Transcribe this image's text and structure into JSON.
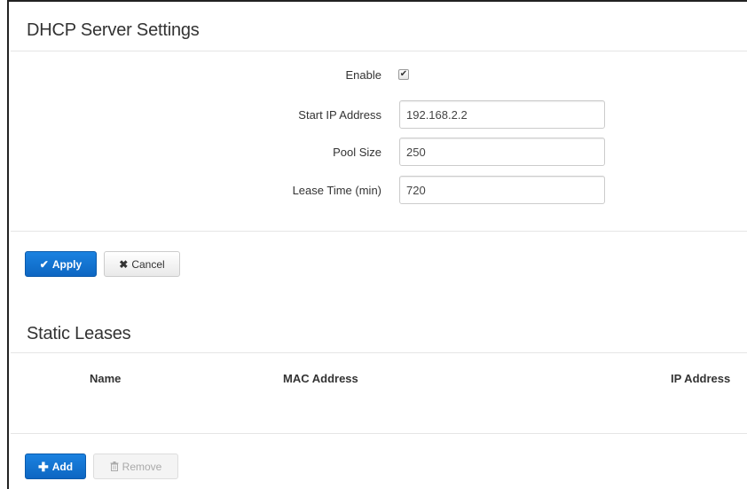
{
  "dhcp": {
    "title": "DHCP Server Settings",
    "enable_label": "Enable",
    "enable_checked": true,
    "start_ip_label": "Start IP Address",
    "start_ip_value": "192.168.2.2",
    "pool_size_label": "Pool Size",
    "pool_size_value": "250",
    "lease_time_label": "Lease Time (min)",
    "lease_time_value": "720"
  },
  "actions": {
    "apply_label": "Apply",
    "cancel_label": "Cancel"
  },
  "static_leases": {
    "title": "Static Leases",
    "columns": [
      "Name",
      "MAC Address",
      "IP Address"
    ],
    "rows": [],
    "add_label": "Add",
    "remove_label": "Remove"
  },
  "icons": {
    "apply": "check-icon",
    "cancel": "close-icon",
    "add": "plus-icon",
    "remove": "trash-icon"
  },
  "colors": {
    "primary": "#1677d2",
    "border": "#cccccc",
    "divider": "#e5e5e5"
  }
}
